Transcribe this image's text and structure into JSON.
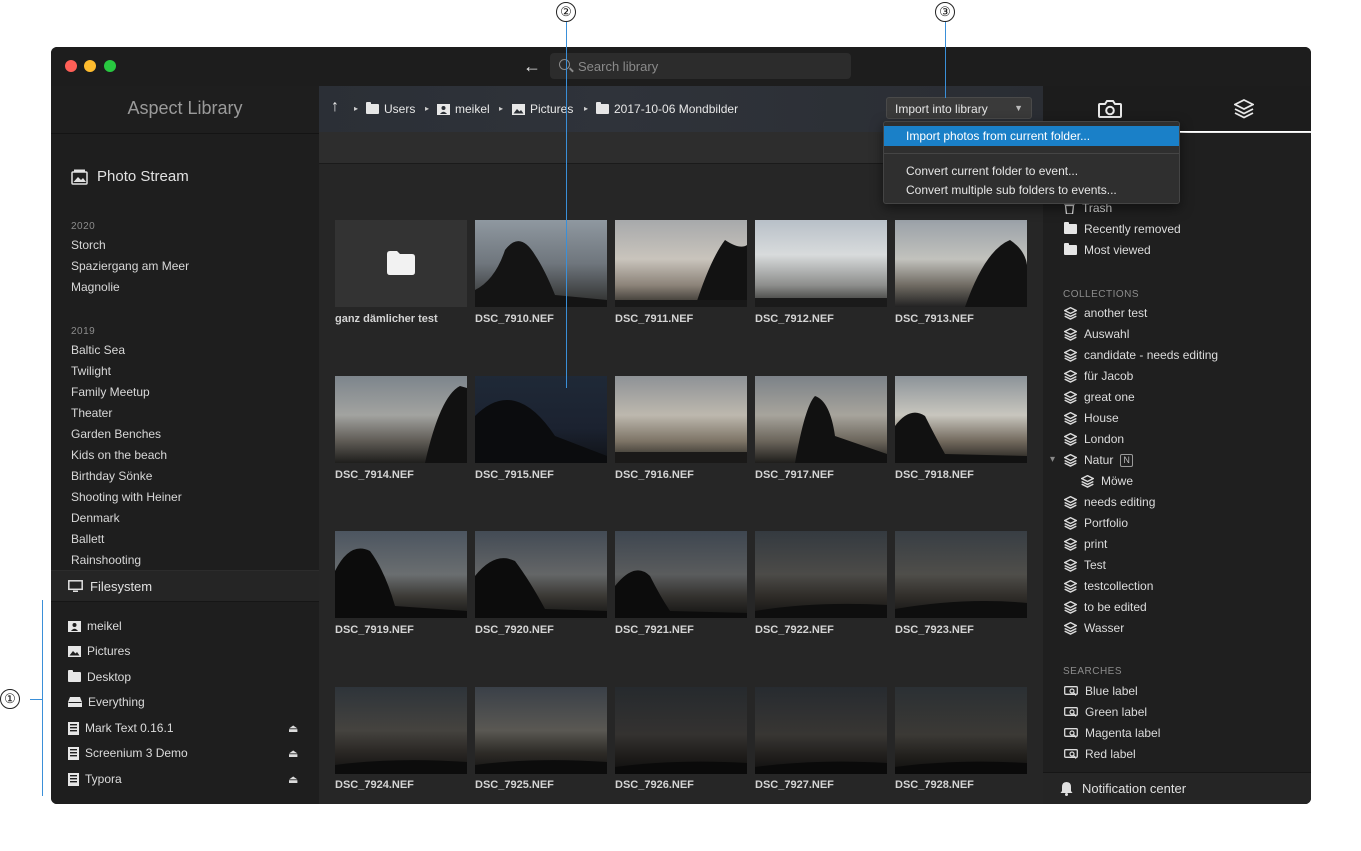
{
  "callouts": {
    "c1": "①",
    "c2": "②",
    "c3": "③"
  },
  "window": {
    "colors": {
      "close": "#ff5f57",
      "minimize": "#febc2e",
      "zoom": "#28c840",
      "accent": "#1a80c8"
    }
  },
  "toolbar": {
    "back_icon": "←",
    "search_placeholder": "Search library"
  },
  "sidebar": {
    "title": "Aspect Library",
    "photo_stream": "Photo Stream",
    "years": [
      {
        "year": "2020",
        "events": [
          "Storch",
          "Spaziergang am Meer",
          "Magnolie"
        ]
      },
      {
        "year": "2019",
        "events": [
          "Baltic Sea",
          "Twilight",
          "Family Meetup",
          "Theater",
          "Garden Benches",
          "Kids on the beach",
          "Birthday Sönke",
          "Shooting with Heiner",
          "Denmark",
          "Ballett",
          "Rainshooting"
        ]
      }
    ],
    "filesystem_label": "Filesystem",
    "filesystem_items": [
      {
        "label": "meikel",
        "icon": "user-folder-icon",
        "eject": false
      },
      {
        "label": "Pictures",
        "icon": "pictures-folder-icon",
        "eject": false
      },
      {
        "label": "Desktop",
        "icon": "folder-icon",
        "eject": false
      },
      {
        "label": "Everything",
        "icon": "drive-icon",
        "eject": false
      },
      {
        "label": "Mark Text 0.16.1",
        "icon": "disk-image-icon",
        "eject": true
      },
      {
        "label": "Screenium 3 Demo",
        "icon": "disk-image-icon",
        "eject": true
      },
      {
        "label": "Typora",
        "icon": "disk-image-icon",
        "eject": true
      }
    ]
  },
  "pathbar": {
    "up_icon": "↑",
    "crumbs": [
      "Users",
      "meikel",
      "Pictures",
      "2017-10-06 Mondbilder"
    ],
    "import_button": "Import into library"
  },
  "dropdown": {
    "items": [
      "Import photos from current folder...",
      "Convert current folder to event...",
      "Convert multiple sub folders to events..."
    ]
  },
  "grid": {
    "items": [
      "ganz dämlicher test",
      "DSC_7910.NEF",
      "DSC_7911.NEF",
      "DSC_7912.NEF",
      "DSC_7913.NEF",
      "DSC_7914.NEF",
      "DSC_7915.NEF",
      "DSC_7916.NEF",
      "DSC_7917.NEF",
      "DSC_7918.NEF",
      "DSC_7919.NEF",
      "DSC_7920.NEF",
      "DSC_7921.NEF",
      "DSC_7922.NEF",
      "DSC_7923.NEF",
      "DSC_7924.NEF",
      "DSC_7925.NEF",
      "DSC_7926.NEF",
      "DSC_7927.NEF",
      "DSC_7928.NEF"
    ]
  },
  "right": {
    "top_items": [
      "Trash",
      "Recently removed",
      "Most viewed"
    ],
    "collections_label": "COLLECTIONS",
    "collections": [
      "another test",
      "Auswahl",
      "candidate - needs editing",
      "für Jacob",
      "great one",
      "House",
      "London",
      "Natur",
      "Möwe",
      "needs editing",
      "Portfolio",
      "print",
      "Test",
      "testcollection",
      "to be edited",
      "Wasser"
    ],
    "natur_badge": "N",
    "searches_label": "SEARCHES",
    "searches": [
      "Blue label",
      "Green label",
      "Magenta label",
      "Red label"
    ],
    "notification": "Notification center"
  }
}
